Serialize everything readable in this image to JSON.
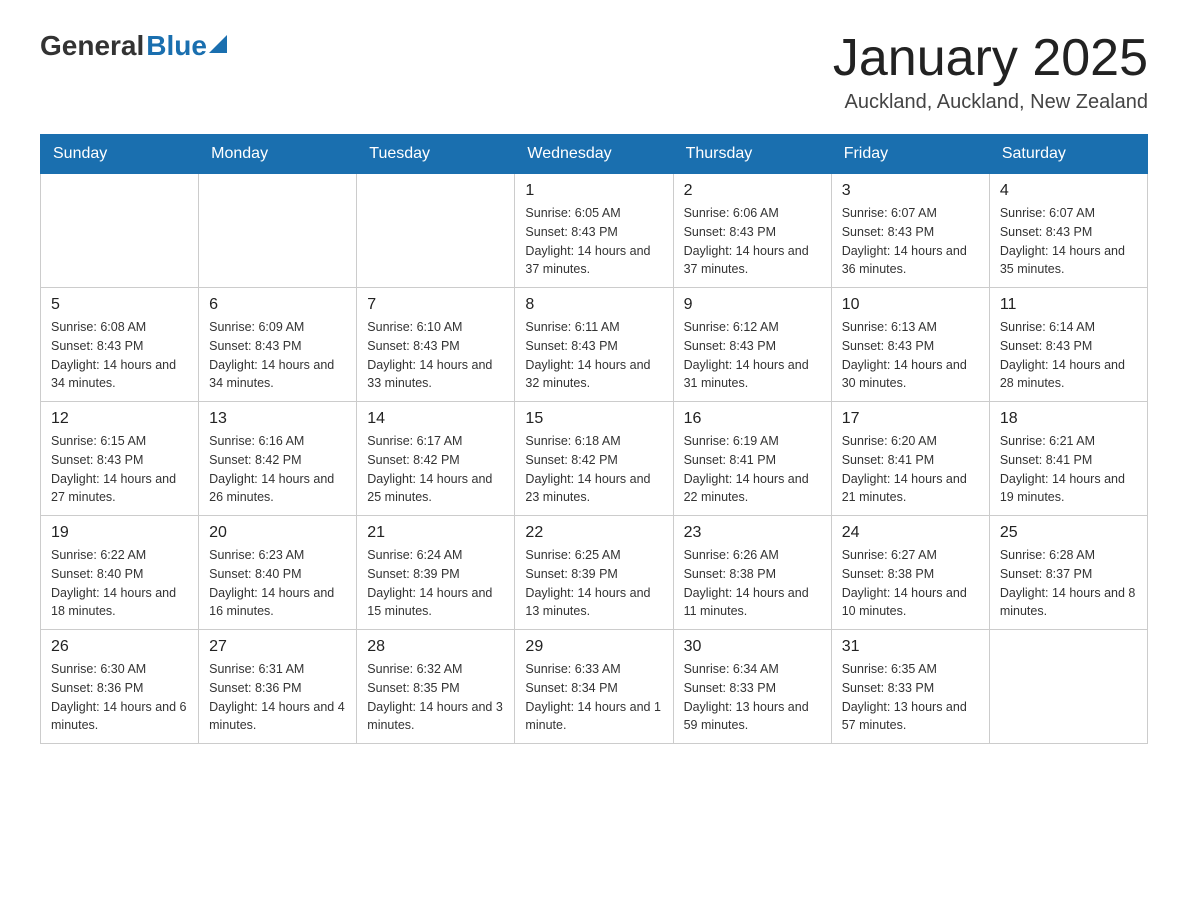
{
  "header": {
    "logo_general": "General",
    "logo_blue": "Blue",
    "month_title": "January 2025",
    "location": "Auckland, Auckland, New Zealand"
  },
  "days_of_week": [
    "Sunday",
    "Monday",
    "Tuesday",
    "Wednesday",
    "Thursday",
    "Friday",
    "Saturday"
  ],
  "weeks": [
    {
      "days": [
        {
          "number": "",
          "info": ""
        },
        {
          "number": "",
          "info": ""
        },
        {
          "number": "",
          "info": ""
        },
        {
          "number": "1",
          "info": "Sunrise: 6:05 AM\nSunset: 8:43 PM\nDaylight: 14 hours and 37 minutes."
        },
        {
          "number": "2",
          "info": "Sunrise: 6:06 AM\nSunset: 8:43 PM\nDaylight: 14 hours and 37 minutes."
        },
        {
          "number": "3",
          "info": "Sunrise: 6:07 AM\nSunset: 8:43 PM\nDaylight: 14 hours and 36 minutes."
        },
        {
          "number": "4",
          "info": "Sunrise: 6:07 AM\nSunset: 8:43 PM\nDaylight: 14 hours and 35 minutes."
        }
      ]
    },
    {
      "days": [
        {
          "number": "5",
          "info": "Sunrise: 6:08 AM\nSunset: 8:43 PM\nDaylight: 14 hours and 34 minutes."
        },
        {
          "number": "6",
          "info": "Sunrise: 6:09 AM\nSunset: 8:43 PM\nDaylight: 14 hours and 34 minutes."
        },
        {
          "number": "7",
          "info": "Sunrise: 6:10 AM\nSunset: 8:43 PM\nDaylight: 14 hours and 33 minutes."
        },
        {
          "number": "8",
          "info": "Sunrise: 6:11 AM\nSunset: 8:43 PM\nDaylight: 14 hours and 32 minutes."
        },
        {
          "number": "9",
          "info": "Sunrise: 6:12 AM\nSunset: 8:43 PM\nDaylight: 14 hours and 31 minutes."
        },
        {
          "number": "10",
          "info": "Sunrise: 6:13 AM\nSunset: 8:43 PM\nDaylight: 14 hours and 30 minutes."
        },
        {
          "number": "11",
          "info": "Sunrise: 6:14 AM\nSunset: 8:43 PM\nDaylight: 14 hours and 28 minutes."
        }
      ]
    },
    {
      "days": [
        {
          "number": "12",
          "info": "Sunrise: 6:15 AM\nSunset: 8:43 PM\nDaylight: 14 hours and 27 minutes."
        },
        {
          "number": "13",
          "info": "Sunrise: 6:16 AM\nSunset: 8:42 PM\nDaylight: 14 hours and 26 minutes."
        },
        {
          "number": "14",
          "info": "Sunrise: 6:17 AM\nSunset: 8:42 PM\nDaylight: 14 hours and 25 minutes."
        },
        {
          "number": "15",
          "info": "Sunrise: 6:18 AM\nSunset: 8:42 PM\nDaylight: 14 hours and 23 minutes."
        },
        {
          "number": "16",
          "info": "Sunrise: 6:19 AM\nSunset: 8:41 PM\nDaylight: 14 hours and 22 minutes."
        },
        {
          "number": "17",
          "info": "Sunrise: 6:20 AM\nSunset: 8:41 PM\nDaylight: 14 hours and 21 minutes."
        },
        {
          "number": "18",
          "info": "Sunrise: 6:21 AM\nSunset: 8:41 PM\nDaylight: 14 hours and 19 minutes."
        }
      ]
    },
    {
      "days": [
        {
          "number": "19",
          "info": "Sunrise: 6:22 AM\nSunset: 8:40 PM\nDaylight: 14 hours and 18 minutes."
        },
        {
          "number": "20",
          "info": "Sunrise: 6:23 AM\nSunset: 8:40 PM\nDaylight: 14 hours and 16 minutes."
        },
        {
          "number": "21",
          "info": "Sunrise: 6:24 AM\nSunset: 8:39 PM\nDaylight: 14 hours and 15 minutes."
        },
        {
          "number": "22",
          "info": "Sunrise: 6:25 AM\nSunset: 8:39 PM\nDaylight: 14 hours and 13 minutes."
        },
        {
          "number": "23",
          "info": "Sunrise: 6:26 AM\nSunset: 8:38 PM\nDaylight: 14 hours and 11 minutes."
        },
        {
          "number": "24",
          "info": "Sunrise: 6:27 AM\nSunset: 8:38 PM\nDaylight: 14 hours and 10 minutes."
        },
        {
          "number": "25",
          "info": "Sunrise: 6:28 AM\nSunset: 8:37 PM\nDaylight: 14 hours and 8 minutes."
        }
      ]
    },
    {
      "days": [
        {
          "number": "26",
          "info": "Sunrise: 6:30 AM\nSunset: 8:36 PM\nDaylight: 14 hours and 6 minutes."
        },
        {
          "number": "27",
          "info": "Sunrise: 6:31 AM\nSunset: 8:36 PM\nDaylight: 14 hours and 4 minutes."
        },
        {
          "number": "28",
          "info": "Sunrise: 6:32 AM\nSunset: 8:35 PM\nDaylight: 14 hours and 3 minutes."
        },
        {
          "number": "29",
          "info": "Sunrise: 6:33 AM\nSunset: 8:34 PM\nDaylight: 14 hours and 1 minute."
        },
        {
          "number": "30",
          "info": "Sunrise: 6:34 AM\nSunset: 8:33 PM\nDaylight: 13 hours and 59 minutes."
        },
        {
          "number": "31",
          "info": "Sunrise: 6:35 AM\nSunset: 8:33 PM\nDaylight: 13 hours and 57 minutes."
        },
        {
          "number": "",
          "info": ""
        }
      ]
    }
  ]
}
